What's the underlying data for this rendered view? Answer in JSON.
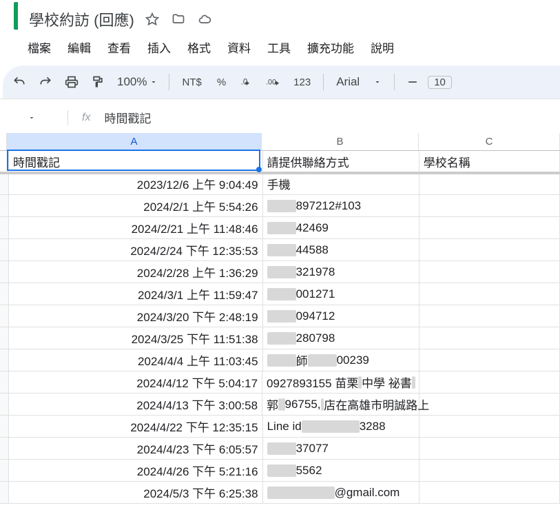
{
  "document": {
    "title": "學校約訪 (回應)"
  },
  "menu": {
    "file": "檔案",
    "edit": "編輯",
    "view": "查看",
    "insert": "插入",
    "format": "格式",
    "data": "資料",
    "tools": "工具",
    "extensions": "擴充功能",
    "help": "說明"
  },
  "toolbar": {
    "zoom": "100%",
    "currency": "NT$",
    "percent": "%",
    "numfmt": "123",
    "font": "Arial",
    "fontsize": "10"
  },
  "namebox": {
    "fx": "fx",
    "value": "時間戳記"
  },
  "columns": {
    "a": "A",
    "b": "B",
    "c": "C"
  },
  "headers": {
    "timestamp": "時間戳記",
    "contact": "請提供聯絡方式",
    "school": "學校名稱"
  },
  "rows": [
    {
      "ts": "2023/12/6 上午 9:04:49",
      "contact": "手機"
    },
    {
      "ts": "2024/2/1 上午 5:54:26",
      "contact": "███897212#103"
    },
    {
      "ts": "2024/2/21 上午 11:48:46",
      "contact": "███42469"
    },
    {
      "ts": "2024/2/24 下午 12:35:53",
      "contact": "███44588"
    },
    {
      "ts": "2024/2/28 上午 1:36:29",
      "contact": "███321978"
    },
    {
      "ts": "2024/3/1 上午 11:59:47",
      "contact": "███001271"
    },
    {
      "ts": "2024/3/20 下午 2:48:19",
      "contact": "███094712"
    },
    {
      "ts": "2024/3/25 下午 11:51:38",
      "contact": "███280798"
    },
    {
      "ts": "2024/4/4 上午 11:03:45",
      "contact": "███師███00239"
    },
    {
      "ts": "2024/4/12 下午 5:04:17",
      "contact": "0927893155 苗栗██中學 祕書███"
    },
    {
      "ts": "2024/4/13 下午 3:00:58",
      "contact": "郭███ ███96755, ██店在高雄市明誠路上"
    },
    {
      "ts": "2024/4/22 下午 12:35:15",
      "contact": "Line id██████3288"
    },
    {
      "ts": "2024/4/23 下午 6:05:57",
      "contact": "███ 37077"
    },
    {
      "ts": "2024/4/26 下午 5:21:16",
      "contact": "███5562"
    },
    {
      "ts": "2024/5/3 下午 6:25:38",
      "contact": "███████@gmail.com"
    }
  ]
}
